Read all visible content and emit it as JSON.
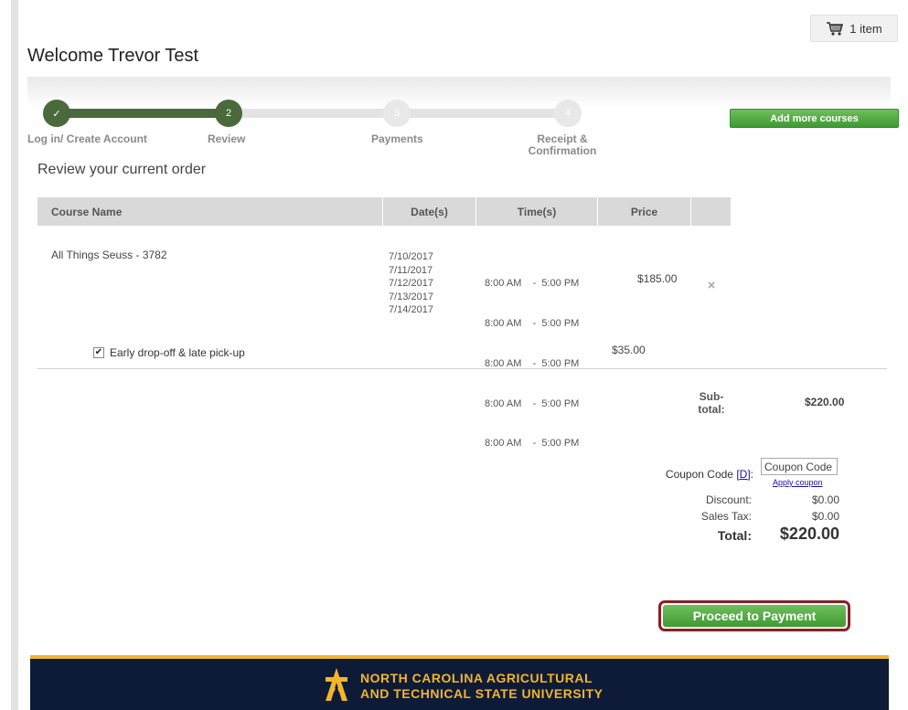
{
  "cart": {
    "label": "1 item",
    "icon": "cart-icon"
  },
  "welcome": "Welcome Trevor Test",
  "steps": [
    {
      "number": "✓",
      "label": "Log in/ Create Account",
      "status": "done"
    },
    {
      "number": "2",
      "label": "Review",
      "status": "active"
    },
    {
      "number": "3",
      "label": "Payments",
      "status": "upcoming"
    },
    {
      "number": "4",
      "label": "Receipt & Confirmation",
      "status": "upcoming"
    }
  ],
  "add_courses_label": "Add more courses",
  "review_heading": "Review your current order",
  "table": {
    "headers": {
      "course": "Course Name",
      "dates": "Date(s)",
      "times": "Time(s)",
      "price": "Price"
    },
    "row": {
      "course": "All Things Seuss - 3782",
      "dates": [
        "7/10/2017",
        "7/11/2017",
        "7/12/2017",
        "7/13/2017",
        "7/14/2017"
      ],
      "times": [
        "8:00 AM    -  5:00 PM",
        "8:00 AM    -  5:00 PM",
        "8:00 AM    -  5:00 PM",
        "8:00 AM    -  5:00 PM",
        "8:00 AM    -  5:00 PM"
      ],
      "price": "$185.00",
      "remove_icon": "remove-icon"
    },
    "addon": {
      "label": "Early drop-off & late pick-up",
      "price": "$35.00",
      "checked": true
    }
  },
  "subtotal": {
    "label": "Sub-total:",
    "value": "$220.00"
  },
  "coupon": {
    "label": "Coupon Code",
    "link": "[D]",
    "placeholder": "Coupon Code",
    "apply": "Apply coupon"
  },
  "discount": {
    "label": "Discount:",
    "value": "$0.00"
  },
  "sales_tax": {
    "label": "Sales Tax:",
    "value": "$0.00"
  },
  "total": {
    "label": "Total:",
    "value": "$220.00"
  },
  "proceed_label": "Proceed to Payment",
  "footer": {
    "line1": "NORTH CAROLINA AGRICULTURAL",
    "line2": "AND TECHNICAL STATE UNIVERSITY",
    "brand_gold": "#f2b52b",
    "brand_navy": "#0e1b36"
  },
  "colors": {
    "button_green": "#4fa93e",
    "step_done": "#4a6a3b",
    "highlight_border": "#8b1f24"
  }
}
